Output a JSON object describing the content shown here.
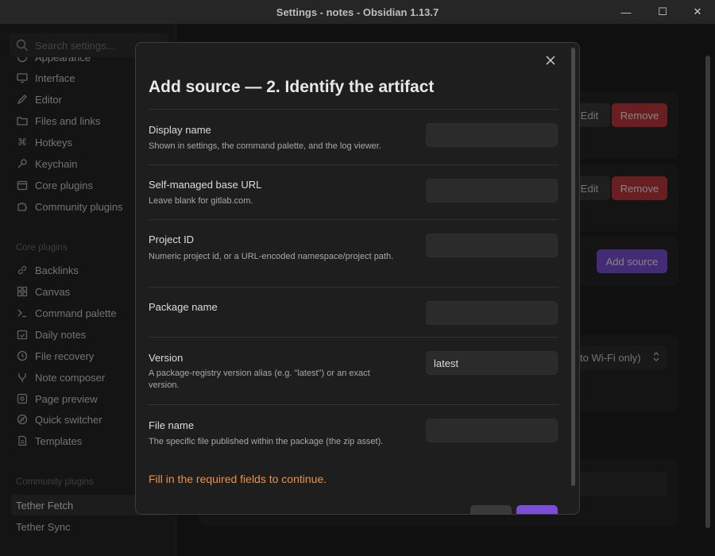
{
  "window": {
    "title": "Settings - notes - Obsidian 1.13.7",
    "minimize_glyph": "—",
    "maximize_glyph": "☐",
    "close_glyph": "✕"
  },
  "sidebar": {
    "search_placeholder": "Search settings...",
    "options_items": [
      {
        "label": "Appearance",
        "icon": "palette-icon"
      },
      {
        "label": "Interface",
        "icon": "monitor-icon"
      },
      {
        "label": "Editor",
        "icon": "pencil-icon"
      },
      {
        "label": "Files and links",
        "icon": "folder-icon"
      },
      {
        "label": "Hotkeys",
        "icon": "command-icon"
      },
      {
        "label": "Keychain",
        "icon": "key-icon"
      },
      {
        "label": "Core plugins",
        "icon": "calendar-icon"
      },
      {
        "label": "Community plugins",
        "icon": "puzzle-icon"
      }
    ],
    "core_plugins_heading": "Core plugins",
    "core_plugins": [
      {
        "label": "Backlinks",
        "icon": "link-icon"
      },
      {
        "label": "Canvas",
        "icon": "grid-icon"
      },
      {
        "label": "Command palette",
        "icon": "terminal-icon"
      },
      {
        "label": "Daily notes",
        "icon": "calendar-check-icon"
      },
      {
        "label": "File recovery",
        "icon": "history-icon"
      },
      {
        "label": "Note composer",
        "icon": "merge-icon"
      },
      {
        "label": "Page preview",
        "icon": "preview-icon"
      },
      {
        "label": "Quick switcher",
        "icon": "compass-icon"
      },
      {
        "label": "Templates",
        "icon": "template-icon"
      }
    ],
    "community_plugins_heading": "Community plugins",
    "community_plugins": [
      {
        "label": "Tether Fetch",
        "active": true
      },
      {
        "label": "Tether Sync",
        "active": false
      }
    ]
  },
  "content": {
    "edit_label": "Edit",
    "remove_label": "Remove",
    "add_source_label": "Add source",
    "dropdown_value": "to Wi-Fi only)"
  },
  "modal": {
    "title": "Add source — 2. Identify the artifact",
    "fields": [
      {
        "label": "Display name",
        "description": "Shown in settings, the command palette, and the log viewer.",
        "value": ""
      },
      {
        "label": "Self-managed base URL",
        "description": "Leave blank for gitlab.com.",
        "value": ""
      },
      {
        "label": "Project ID",
        "description": "Numeric project id, or a URL-encoded namespace/project path.",
        "value": ""
      },
      {
        "label": "Package name",
        "description": "",
        "value": ""
      },
      {
        "label": "Version",
        "description": "A package-registry version alias (e.g. \"latest\") or an exact version.",
        "value": "latest"
      },
      {
        "label": "File name",
        "description": "The specific file published within the package (the zip asset).",
        "value": ""
      }
    ],
    "warning": "Fill in the required fields to continue."
  },
  "colors": {
    "accent": "#7a4fd6",
    "danger": "#c0383c",
    "warning": "#e8914a"
  }
}
